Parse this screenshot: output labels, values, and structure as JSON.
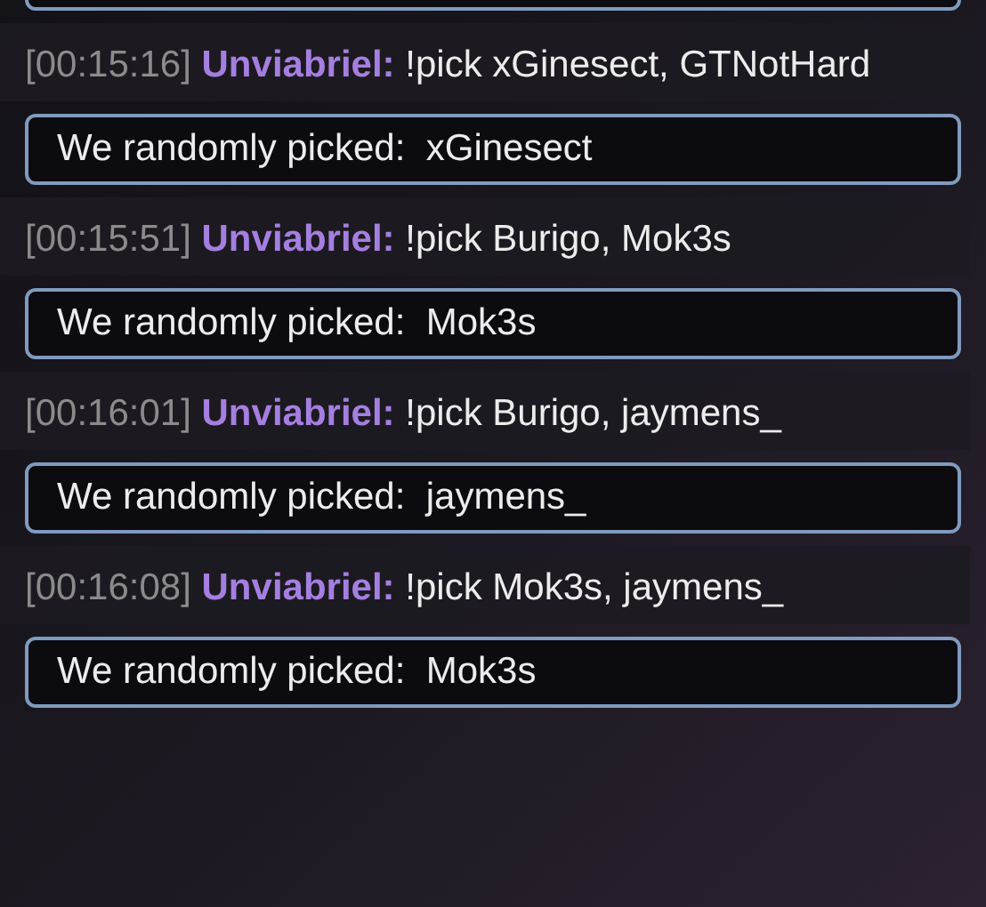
{
  "messages": [
    {
      "time": "[00:15:16]",
      "user": "Unviabriel:",
      "text": "!pick xGinesect, GTNotHard",
      "reply": "We randomly picked:  xGinesect"
    },
    {
      "time": "[00:15:51]",
      "user": "Unviabriel:",
      "text": "!pick Burigo, Mok3s",
      "reply": "We randomly picked:  Mok3s"
    },
    {
      "time": "[00:16:01]",
      "user": "Unviabriel:",
      "text": "!pick Burigo, jaymens_",
      "reply": "We randomly picked:  jaymens_"
    },
    {
      "time": "[00:16:08]",
      "user": "Unviabriel:",
      "text": "!pick Mok3s, jaymens_",
      "reply": "We randomly picked:  Mok3s"
    }
  ]
}
